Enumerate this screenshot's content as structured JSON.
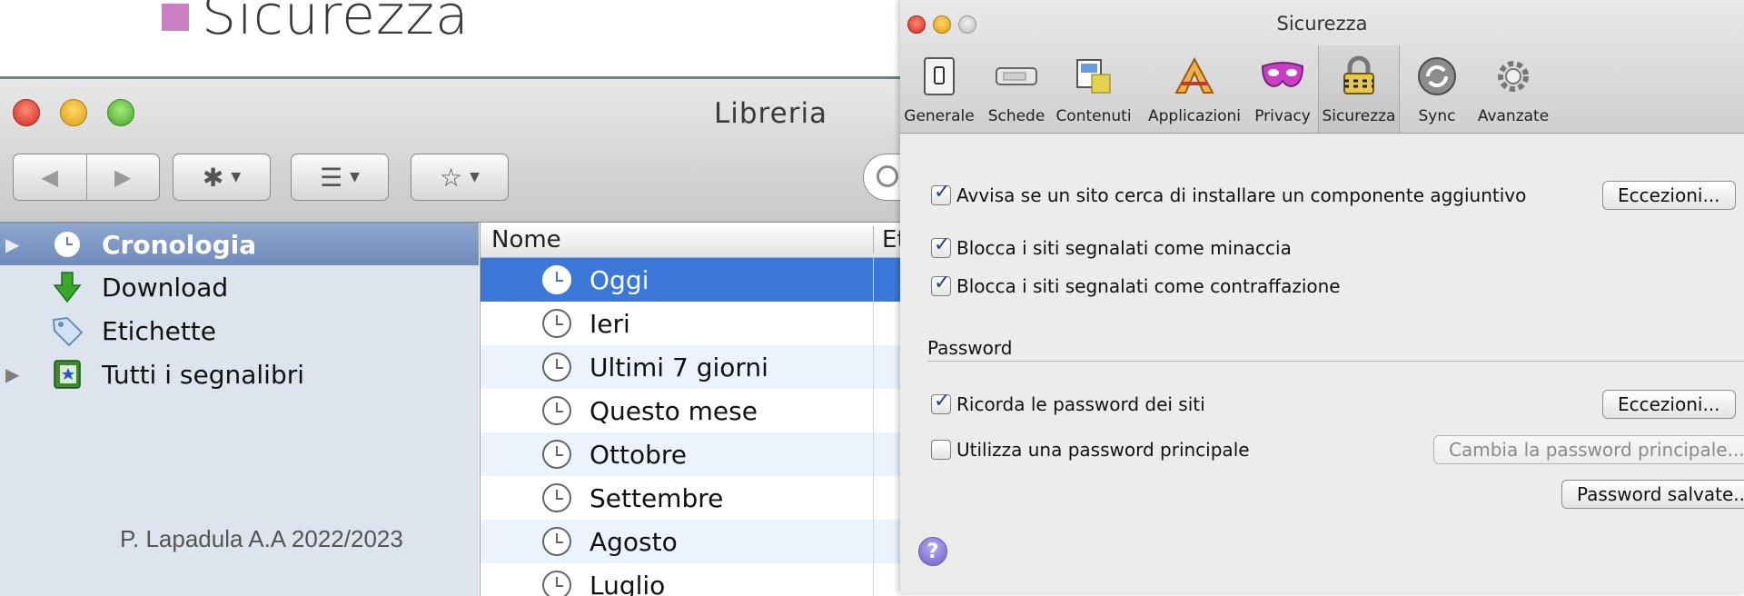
{
  "slide": {
    "title": "Sicurezza",
    "footer": "P. Lapadula  A.A 2022/2023"
  },
  "library": {
    "title": "Libreria",
    "sidebar": {
      "items": [
        {
          "label": "Cronologia",
          "icon": "clock-icon",
          "selected": true
        },
        {
          "label": "Download",
          "icon": "download-arrow-icon"
        },
        {
          "label": "Etichette",
          "icon": "tag-icon"
        },
        {
          "label": "Tutti i segnalibri",
          "icon": "bookmarks-book-icon"
        }
      ]
    },
    "list": {
      "columns": [
        "Nome",
        "Et"
      ],
      "rows": [
        "Oggi",
        "Ieri",
        "Ultimi 7 giorni",
        "Questo mese",
        "Ottobre",
        "Settembre",
        "Agosto",
        "Luglio"
      ],
      "selected_row": "Oggi"
    }
  },
  "prefs": {
    "title": "Sicurezza",
    "tabs": [
      {
        "label": "Generale",
        "icon": "switch-icon"
      },
      {
        "label": "Schede",
        "icon": "tabs-icon"
      },
      {
        "label": "Contenuti",
        "icon": "content-icon"
      },
      {
        "label": "Applicazioni",
        "icon": "applications-icon"
      },
      {
        "label": "Privacy",
        "icon": "mask-icon"
      },
      {
        "label": "Sicurezza",
        "icon": "padlock-icon",
        "active": true
      },
      {
        "label": "Sync",
        "icon": "sync-icon"
      },
      {
        "label": "Avanzate",
        "icon": "gear-icon"
      }
    ],
    "options": [
      {
        "label": "Avvisa se un sito cerca di installare un componente aggiuntivo",
        "checked": true
      },
      {
        "label": "Blocca i siti segnalati come minaccia",
        "checked": true
      },
      {
        "label": "Blocca i siti segnalati come contraffazione",
        "checked": true
      }
    ],
    "exceptions_button": "Eccezioni...",
    "password_section": {
      "label": "Password",
      "remember": {
        "label": "Ricorda le password dei siti",
        "checked": true
      },
      "master": {
        "label": "Utilizza una password principale",
        "checked": false
      },
      "exceptions_button": "Eccezioni...",
      "change_master_button": "Cambia la password principale...",
      "saved_passwords_button": "Password salvate..."
    },
    "help": "?"
  },
  "colors": {
    "selection": "#3c78d8",
    "sidebar_bg": "#dde4ed",
    "bullet": "#c97fc0"
  }
}
